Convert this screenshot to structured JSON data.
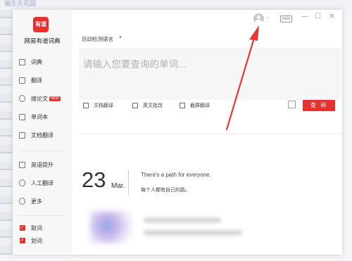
{
  "desktop": {
    "top_text": "福生天花园"
  },
  "app": {
    "logo_text": "有道",
    "name": "网易有道词典"
  },
  "sidebar": {
    "items": [
      {
        "label": "词典",
        "icon": "dictionary-icon"
      },
      {
        "label": "翻译",
        "icon": "translate-icon"
      },
      {
        "label": "搜论文",
        "icon": "search-paper-icon",
        "badge": "NEW"
      },
      {
        "label": "单词本",
        "icon": "wordbook-icon"
      },
      {
        "label": "文档翻译",
        "icon": "document-icon"
      },
      {
        "label": "英语提升",
        "icon": "play-icon"
      },
      {
        "label": "人工翻译",
        "icon": "headset-icon"
      },
      {
        "label": "更多",
        "icon": "more-icon"
      }
    ],
    "toggles": [
      {
        "label": "取词",
        "checked": true
      },
      {
        "label": "划词",
        "checked": true
      }
    ]
  },
  "titlebar": {
    "mini_label": "mini",
    "minimize_glyph": "—",
    "maximize_glyph": "☐",
    "close_glyph": "✕"
  },
  "search": {
    "language_label": "自动检测语言",
    "placeholder": "请输入您要查询的单词...",
    "value": "",
    "query_button": "查 询"
  },
  "tools": [
    {
      "label": "文档翻译",
      "icon": "document-translate-icon"
    },
    {
      "label": "英文批改",
      "icon": "english-correction-icon"
    },
    {
      "label": "截屏翻译",
      "icon": "screenshot-translate-icon"
    }
  ],
  "daily": {
    "day": "23",
    "month": "Mar.",
    "sentence_en": "There's a path for everyone.",
    "sentence_cn": "每个人都有自己的路。"
  },
  "colors": {
    "brand_red": "#e8312f",
    "annotation_red": "#e53935"
  }
}
